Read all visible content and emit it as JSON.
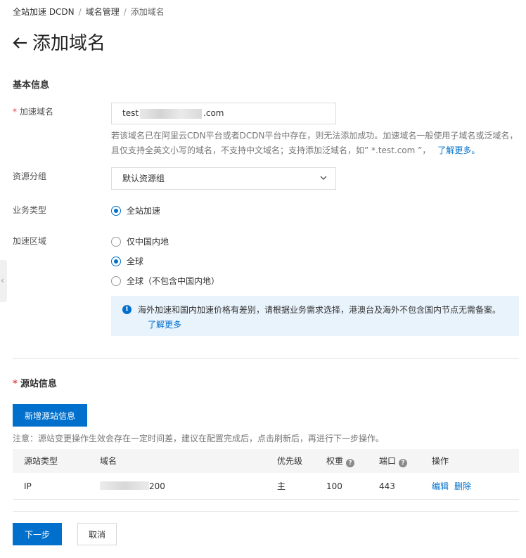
{
  "breadcrumb": {
    "items": [
      "全站加速 DCDN",
      "域名管理",
      "添加域名"
    ],
    "separator": "/"
  },
  "page": {
    "back_icon": "arrow-left-icon",
    "title": "添加域名"
  },
  "basic": {
    "section_title": "基本信息",
    "domain_label": "加速域名",
    "domain_value_prefix": "test",
    "domain_value_suffix": ".com",
    "domain_hint_line1": "若该域名已在阿里云CDN平台或者DCDN平台中存在，则无法添加成功。加速域名一般使用子域名或泛域名，",
    "domain_hint_line2": "且仅支持全英文小写的域名，不支持中文域名；支持添加泛域名，如” *.test.com ”，",
    "domain_hint_link": "了解更多。",
    "resource_group_label": "资源分组",
    "resource_group_value": "默认资源组",
    "business_type_label": "业务类型",
    "business_type_option": "全站加速",
    "region_label": "加速区域",
    "region_options": [
      "仅中国内地",
      "全球",
      "全球（不包含中国内地）"
    ],
    "region_selected": "全球",
    "info_text": "海外加速和国内加速价格有差别，请根据业务需求选择，港澳台及海外不包含国内节点无需备案。",
    "info_link": "了解更多"
  },
  "origin": {
    "section_title": "源站信息",
    "add_button": "新增源站信息",
    "note": "注意：源站变更操作生效会存在一定时间差，建议在配置完成后，点击刷新后，再进行下一步操作。",
    "columns": [
      "源站类型",
      "域名",
      "优先级",
      "权重",
      "端口",
      "操作"
    ],
    "rows": [
      {
        "type": "IP",
        "domain_suffix": "200",
        "priority": "主",
        "weight": "100",
        "port": "443",
        "edit": "编辑",
        "delete": "删除"
      }
    ]
  },
  "footer": {
    "next": "下一步",
    "cancel": "取消"
  },
  "colors": {
    "primary": "#0070cc",
    "required": "#e64545",
    "info_bg": "#e9f3fc"
  }
}
